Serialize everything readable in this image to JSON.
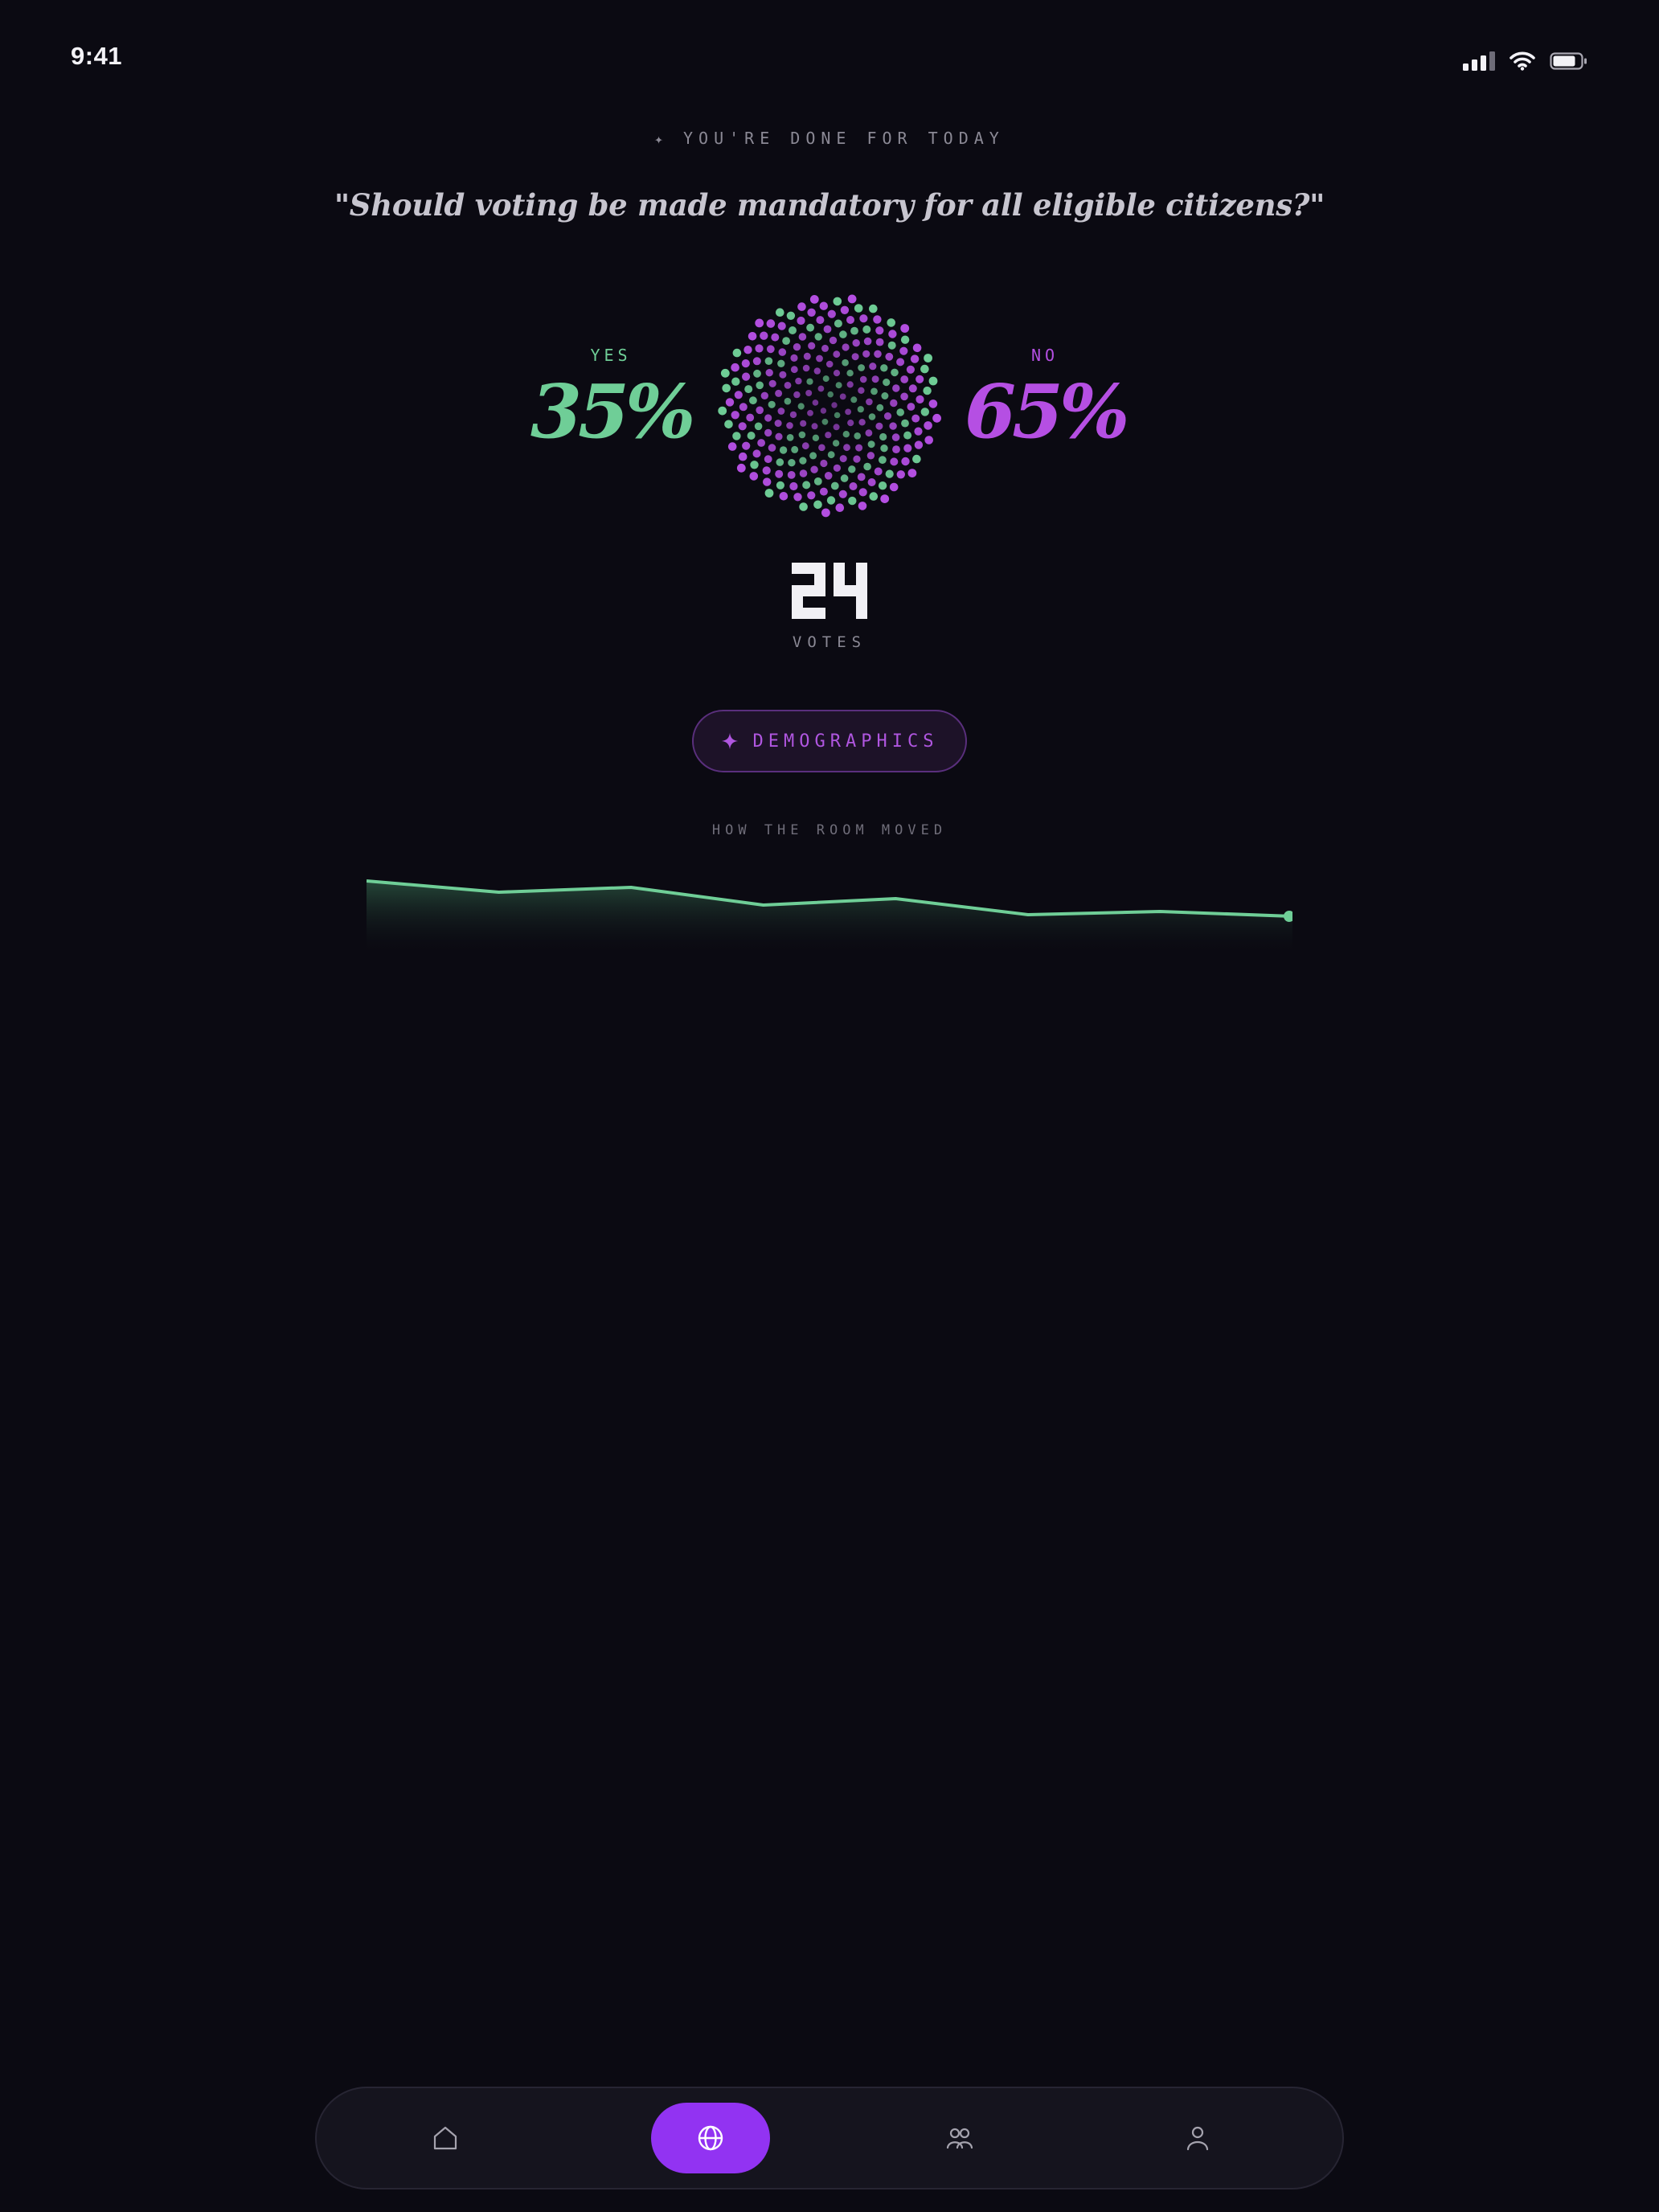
{
  "status_bar": {
    "time": "9:41"
  },
  "header": {
    "kicker": "YOU'RE DONE FOR TODAY",
    "question": "\"Should voting be made mandatory for all eligible citizens?\""
  },
  "results": {
    "yes": {
      "label": "YES",
      "percent_text": "35%",
      "percent": 35,
      "color": "#6fce97"
    },
    "no": {
      "label": "NO",
      "percent_text": "65%",
      "percent": 65,
      "color": "#b54fe3"
    }
  },
  "votes": {
    "count": "24",
    "label": "VOTES"
  },
  "demographics_button": {
    "label": "DEMOGRAPHICS"
  },
  "room_trend": {
    "title": "HOW THE ROOM MOVED",
    "line_color": "#6fce97",
    "yes_share_history": [
      0.52,
      0.45,
      0.48,
      0.37,
      0.41,
      0.31,
      0.33,
      0.3
    ]
  },
  "tab_bar": {
    "tabs": [
      {
        "icon": "home-icon",
        "active": false
      },
      {
        "icon": "globe-icon",
        "active": true
      },
      {
        "icon": "groups-icon",
        "active": false
      },
      {
        "icon": "profile-icon",
        "active": false
      }
    ],
    "active_color": "#9233f2"
  }
}
